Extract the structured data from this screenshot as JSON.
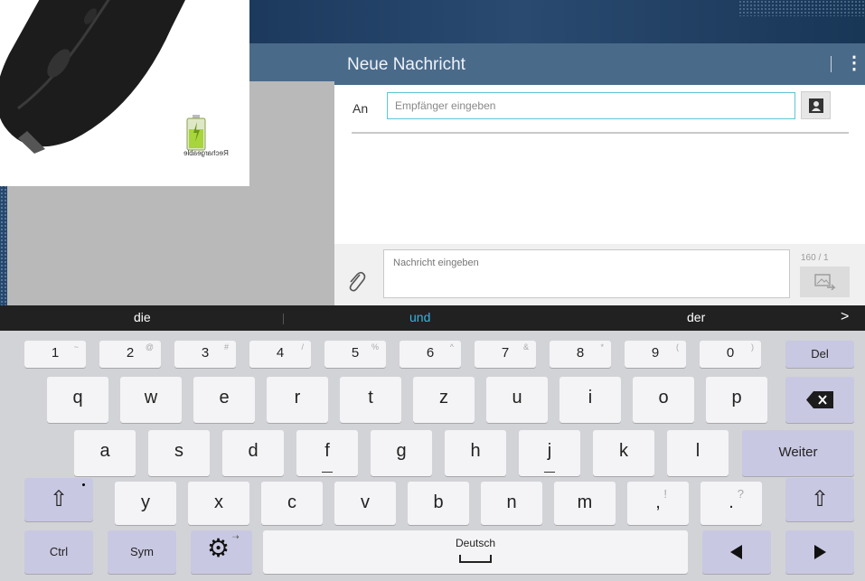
{
  "product": {
    "caption": "Rechargeable",
    "colors": {
      "mouse": "#1a1a1a",
      "battery": "#a8d43c"
    }
  },
  "compose": {
    "title": "Neue Nachricht",
    "to_label": "An",
    "recipient_placeholder": "Empfänger eingeben",
    "message_placeholder": "Nachricht eingeben",
    "char_count": "160 / 1",
    "icons": {
      "menu": "overflow-menu-icon",
      "contact": "contact-icon",
      "attach": "paperclip-icon",
      "send": "send-mms-icon"
    },
    "colors": {
      "header": "#4a6a8a",
      "input_focus": "#5fc5d3"
    }
  },
  "suggestions": {
    "items": [
      "die",
      "und",
      "der"
    ],
    "highlight_color": "#34b5e5",
    "arrow": ">"
  },
  "keyboard": {
    "row1": [
      {
        "key": "1",
        "hint": "~"
      },
      {
        "key": "2",
        "hint": "@"
      },
      {
        "key": "3",
        "hint": "#"
      },
      {
        "key": "4",
        "hint": "/"
      },
      {
        "key": "5",
        "hint": "%"
      },
      {
        "key": "6",
        "hint": "^"
      },
      {
        "key": "7",
        "hint": "&"
      },
      {
        "key": "8",
        "hint": "*"
      },
      {
        "key": "9",
        "hint": "("
      },
      {
        "key": "0",
        "hint": ")"
      }
    ],
    "del_label": "Del",
    "row2": [
      "q",
      "w",
      "e",
      "r",
      "t",
      "z",
      "u",
      "i",
      "o",
      "p"
    ],
    "row3": [
      "a",
      "s",
      "d",
      "f",
      "g",
      "h",
      "j",
      "k",
      "l"
    ],
    "enter_label": "Weiter",
    "row4": [
      {
        "key": "y",
        "hint": ""
      },
      {
        "key": "x",
        "hint": ""
      },
      {
        "key": "c",
        "hint": ""
      },
      {
        "key": "v",
        "hint": ""
      },
      {
        "key": "b",
        "hint": ""
      },
      {
        "key": "n",
        "hint": ""
      },
      {
        "key": "m",
        "hint": ""
      },
      {
        "key": ",",
        "hint": "!"
      },
      {
        "key": ".",
        "hint": "?"
      }
    ],
    "shift_symbol": "⇧",
    "ctrl_label": "Ctrl",
    "sym_label": "Sym",
    "space_label": "Deutsch",
    "icons": {
      "backspace": "backspace-icon",
      "settings": "gear-icon",
      "left": "arrow-left-icon",
      "right": "arrow-right-icon"
    },
    "colors": {
      "function_key": "#c9c8e2",
      "key": "#f4f4f6",
      "board": "#d2d3d7"
    }
  }
}
